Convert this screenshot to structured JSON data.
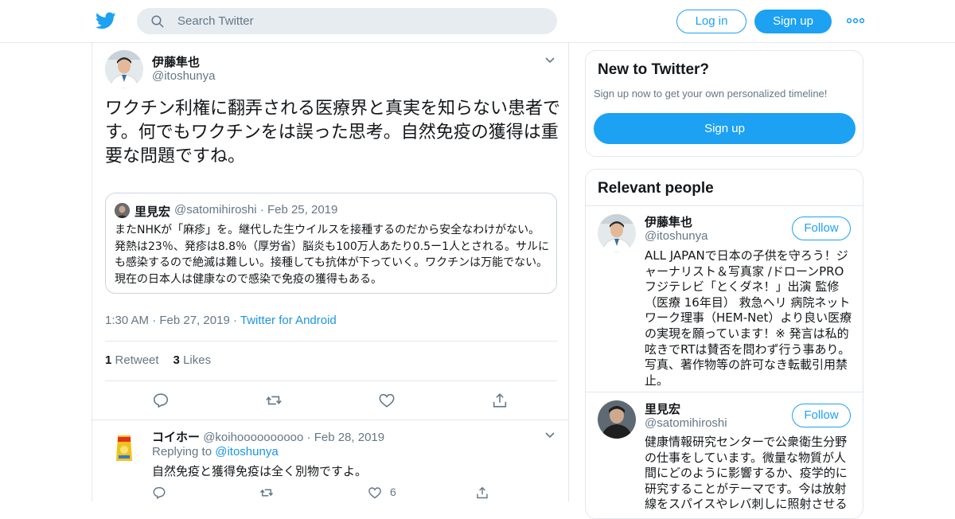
{
  "topbar": {
    "logo_icon": "twitter-bird-icon",
    "search_placeholder": "Search Twitter",
    "login_label": "Log in",
    "signup_label": "Sign up",
    "more_icon": "more-dots-icon",
    "accent": "#1da1f2"
  },
  "tweet": {
    "name": "伊藤隼也",
    "handle": "@itoshunya",
    "text": "ワクチン利権に翻弄される医療界と真実を知らない患者です。何でもワクチンをは誤った思考。自然免疫の獲得は重要な問題ですね。",
    "quote": {
      "name": "里見宏",
      "handle": "@satomihiroshi",
      "date": "Feb 25, 2019",
      "text": "またNHKが「麻疹」を。継代した生ウイルスを接種するのだから安全なわけがない。発熱は23％、発疹は8.8％（厚労省）脳炎も100万人あたり0.5ー1人とされる。サルにも感染するので絶滅は難しい。接種しても抗体が下っていく。ワクチンは万能でない。現在の日本人は健康なので感染で免疫の獲得もある。"
    },
    "time": "1:30 AM",
    "date": "Feb 27, 2019",
    "source": "Twitter for Android",
    "retweets": {
      "count": "1",
      "label": "Retweet"
    },
    "likes": {
      "count": "3",
      "label": "Likes"
    },
    "actions": [
      "reply-icon",
      "retweet-icon",
      "like-icon",
      "share-icon"
    ]
  },
  "reply": {
    "name": "コイホー",
    "handle": "@koihoooooooooo",
    "date": "Feb 28, 2019",
    "replying_label": "Replying to",
    "replying_handle": "@itoshunya",
    "text": "自然免疫と獲得免疫は全く別物ですよ。",
    "like_count": "6"
  },
  "sidebar": {
    "new": {
      "title": "New to Twitter?",
      "subtitle": "Sign up now to get your own personalized timeline!",
      "button": "Sign up"
    },
    "relevant": {
      "title": "Relevant people",
      "people": [
        {
          "name": "伊藤隼也",
          "handle": "@itoshunya",
          "follow": "Follow",
          "bio": "ALL JAPANで日本の子供を守ろう！ジャーナリスト＆写真家 /ドローンPRO フジテレビ「とくダネ！」出演 監修（医療 16年目） 救急ヘリ 病院ネットワーク理事（HEM-Net）より良い医療の実現を願っています！※ 発言は私的呟きでRTは賛否を問わず行う事あり。写真、著作物等の許可なき転載引用禁止。"
        },
        {
          "name": "里見宏",
          "handle": "@satomihiroshi",
          "follow": "Follow",
          "bio": "健康情報研究センターで公衆衛生分野の仕事をしています。微量な物質が人間にどのように影響するか、疫学的に研究することがテーマです。今は放射線をスパイスやレバ刺しに照射させる"
        }
      ]
    }
  }
}
